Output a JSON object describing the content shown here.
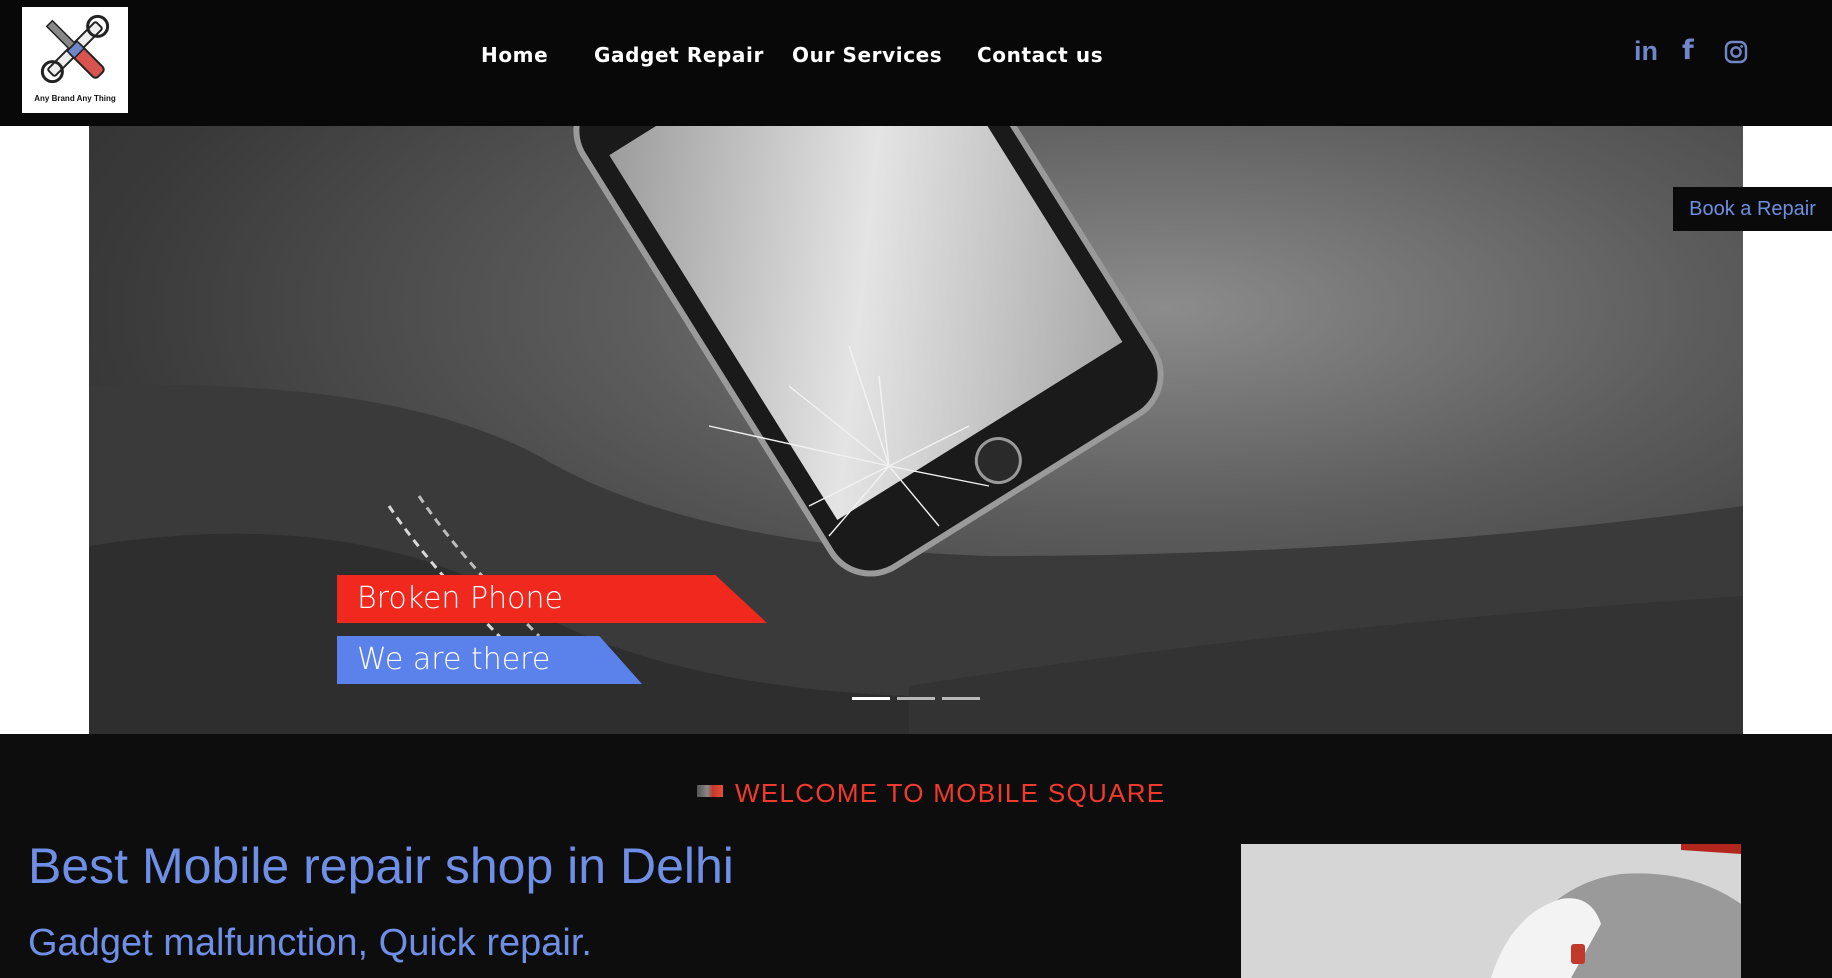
{
  "header": {
    "logo_text": "Any Brand Any Thing",
    "nav": [
      {
        "label": "Home"
      },
      {
        "label": "Gadget Repair"
      },
      {
        "label": "Our Services"
      },
      {
        "label": "Contact us"
      }
    ],
    "socials": [
      "linkedin-icon",
      "facebook-icon",
      "instagram-icon"
    ],
    "social_glyphs": {
      "linkedin": "in",
      "facebook": "f"
    }
  },
  "hero": {
    "book_button": "Book a Repair",
    "tag_primary": "Broken Phone",
    "tag_secondary": "We are there",
    "slides_total": 3,
    "slide_active": 1
  },
  "welcome": {
    "title": "WELCOME TO MOBILE SQUARE",
    "heading": "Best Mobile repair shop in Delhi",
    "subheading": "Gadget malfunction, Quick repair."
  },
  "colors": {
    "accent_blue": "#6f8fe6",
    "accent_red": "#f03a2e",
    "header_bg": "#080808"
  }
}
